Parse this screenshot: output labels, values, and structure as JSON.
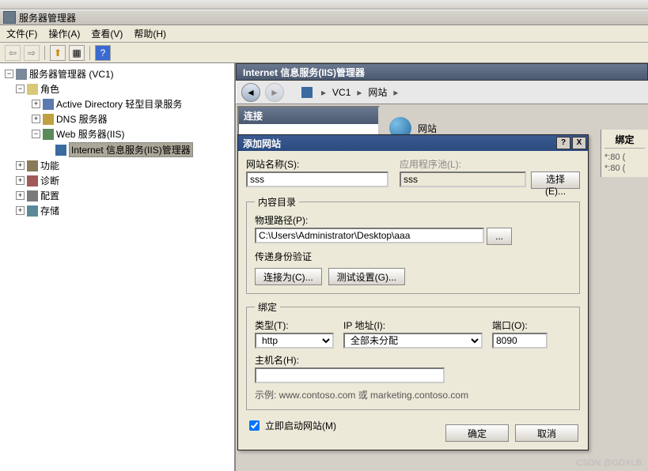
{
  "window": {
    "title": "服务器管理器"
  },
  "menu": {
    "file": "文件(F)",
    "action": "操作(A)",
    "view": "查看(V)",
    "help": "帮助(H)"
  },
  "tree": {
    "root": "服务器管理器 (VC1)",
    "roles": "角色",
    "ad": "Active Directory 轻型目录服务",
    "dns": "DNS 服务器",
    "web": "Web 服务器(IIS)",
    "iis": "Internet 信息服务(IIS)管理器",
    "features": "功能",
    "diag": "诊断",
    "config": "配置",
    "storage": "存储"
  },
  "iis": {
    "title": "Internet 信息服务(IIS)管理器",
    "crumb_host": "VC1",
    "crumb_sites": "网站",
    "conn_header": "连接",
    "sites_header": "网站"
  },
  "right": {
    "binding": "绑定",
    "row1": "*:80 (",
    "row2": "*:80 ("
  },
  "dialog": {
    "title": "添加网站",
    "site_name_lbl": "网站名称(S):",
    "site_name_val": "sss",
    "app_pool_lbl": "应用程序池(L):",
    "app_pool_val": "sss",
    "select_btn": "选择(E)...",
    "content_legend": "内容目录",
    "phys_path_lbl": "物理路径(P):",
    "phys_path_val": "C:\\Users\\Administrator\\Desktop\\aaa",
    "browse_btn": "...",
    "auth_lbl": "传递身份验证",
    "connect_as_btn": "连接为(C)...",
    "test_btn": "测试设置(G)...",
    "binding_legend": "绑定",
    "type_lbl": "类型(T):",
    "type_val": "http",
    "ip_lbl": "IP 地址(I):",
    "ip_val": "全部未分配",
    "port_lbl": "端口(O):",
    "port_val": "8090",
    "host_lbl": "主机名(H):",
    "host_val": "",
    "example": "示例: www.contoso.com 或 marketing.contoso.com",
    "start_now": "立即启动网站(M)",
    "ok": "确定",
    "cancel": "取消"
  },
  "watermark": "CSDN @GDXLB"
}
